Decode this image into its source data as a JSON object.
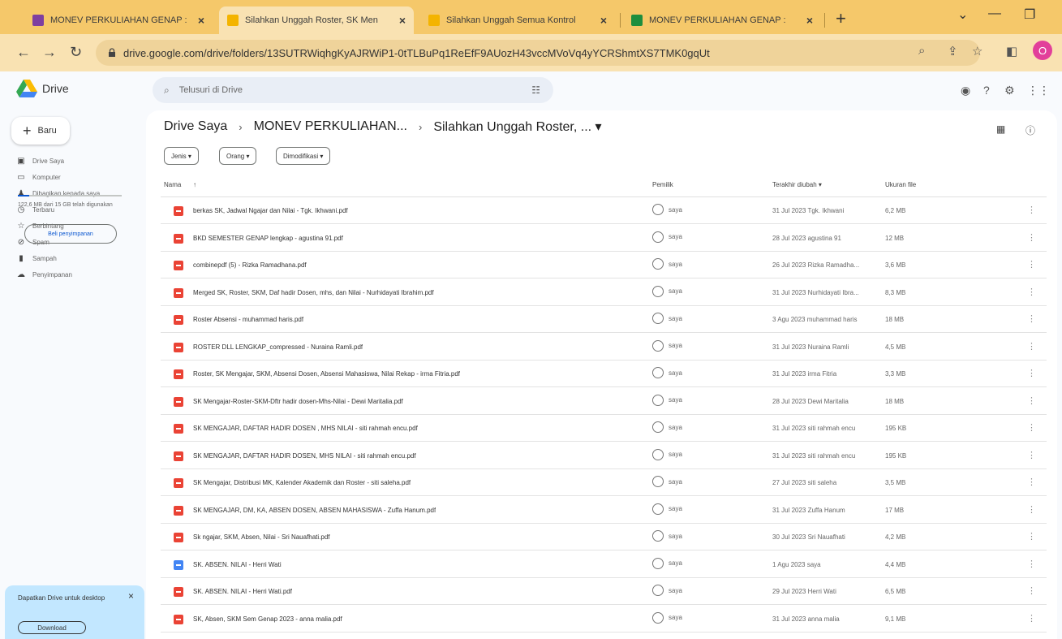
{
  "browser": {
    "tabs": [
      {
        "title": "MONEV PERKULIAHAN GENAP :",
        "color": "#7e3fa0"
      },
      {
        "title": "Silahkan Unggah Roster, SK Men",
        "color": "#f4b400"
      },
      {
        "title": "Silahkan Unggah Semua Kontrol",
        "color": "#f4b400"
      },
      {
        "title": "MONEV PERKULIAHAN GENAP :",
        "color": "#1e8e3e"
      }
    ],
    "url": "drive.google.com/drive/folders/13SUTRWiqhgKyAJRWiP1-0tTLBuPq1ReEfF9AUozH43vccMVoVq4yYCRShmtXS7TMK0gqUt",
    "profile_initial": "O"
  },
  "drive": {
    "logo_text": "Drive",
    "search_placeholder": "Telusuri di Drive",
    "new_label": "Baru",
    "nav": [
      {
        "label": "Drive Saya",
        "icon": "▣"
      },
      {
        "label": "Komputer",
        "icon": "▭"
      },
      {
        "label": "Dibagikan kepada saya",
        "icon": "♟"
      },
      {
        "label": "Terbaru",
        "icon": "◷"
      },
      {
        "label": "Berbintang",
        "icon": "☆"
      },
      {
        "label": "Spam",
        "icon": "⊘"
      },
      {
        "label": "Sampah",
        "icon": "▮"
      },
      {
        "label": "Penyimpanan",
        "icon": "☁"
      }
    ],
    "storage_text": "122,6 MB dari 15 GB telah digunakan",
    "buy_storage": "Beli penyimpanan",
    "promo_text": "Dapatkan Drive untuk desktop",
    "promo_button": "Download",
    "breadcrumb": [
      "Drive Saya",
      "MONEV PERKULIAHAN...",
      "Silahkan Unggah Roster, ... ▾"
    ],
    "filters": [
      "Jenis ▾",
      "Orang ▾",
      "Dimodifikasi ▾"
    ],
    "columns": {
      "name": "Nama",
      "owner": "Pemilik",
      "modified": "Terakhir diubah ▾",
      "size": "Ukuran file"
    },
    "files": [
      {
        "name": "berkas SK, Jadwal Ngajar dan Nilai - Tgk. Ikhwani.pdf",
        "type": "pdf",
        "owner": "saya",
        "modified": "31 Jul 2023 Tgk. Ikhwani",
        "size": "6,2 MB"
      },
      {
        "name": "BKD SEMESTER GENAP lengkap - agustina 91.pdf",
        "type": "pdf",
        "owner": "saya",
        "modified": "28 Jul 2023 agustina 91",
        "size": "12 MB"
      },
      {
        "name": "combinepdf (5) - Rizka Ramadhana.pdf",
        "type": "pdf",
        "owner": "saya",
        "modified": "26 Jul 2023 Rizka Ramadha...",
        "size": "3,6 MB"
      },
      {
        "name": "Merged SK, Roster, SKM, Daf hadir Dosen, mhs, dan Nilai - Nurhidayati Ibrahim.pdf",
        "type": "pdf",
        "owner": "saya",
        "modified": "31 Jul 2023 Nurhidayati Ibra...",
        "size": "8,3 MB"
      },
      {
        "name": "Roster Absensi - muhammad haris.pdf",
        "type": "pdf",
        "owner": "saya",
        "modified": "3 Agu 2023 muhammad haris",
        "size": "18 MB"
      },
      {
        "name": "ROSTER DLL LENGKAP_compressed - Nuraina Ramli.pdf",
        "type": "pdf",
        "owner": "saya",
        "modified": "31 Jul 2023 Nuraina Ramli",
        "size": "4,5 MB"
      },
      {
        "name": "Roster, SK Mengajar, SKM, Absensi Dosen, Absensi Mahasiswa, Nilai Rekap - irma Fitria.pdf",
        "type": "pdf",
        "owner": "saya",
        "modified": "31 Jul 2023 irma Fitria",
        "size": "3,3 MB"
      },
      {
        "name": "SK Mengajar-Roster-SKM-Dftr hadir dosen-Mhs-Nilai - Dewi Maritalia.pdf",
        "type": "pdf",
        "owner": "saya",
        "modified": "28 Jul 2023 Dewi Maritalia",
        "size": "18 MB"
      },
      {
        "name": "SK MENGAJAR, DAFTAR HADIR DOSEN , MHS NILAI - siti rahmah encu.pdf",
        "type": "pdf",
        "owner": "saya",
        "modified": "31 Jul 2023 siti rahmah encu",
        "size": "195 KB"
      },
      {
        "name": "SK MENGAJAR, DAFTAR HADIR DOSEN, MHS NILAI - siti rahmah encu.pdf",
        "type": "pdf",
        "owner": "saya",
        "modified": "31 Jul 2023 siti rahmah encu",
        "size": "195 KB"
      },
      {
        "name": "SK Mengajar, Distribusi MK, Kalender Akademik dan Roster - siti saleha.pdf",
        "type": "pdf",
        "owner": "saya",
        "modified": "27 Jul 2023 siti saleha",
        "size": "3,5 MB"
      },
      {
        "name": "SK MENGAJAR, DM, KA, ABSEN DOSEN, ABSEN MAHASISWA - Zuffa Hanum.pdf",
        "type": "pdf",
        "owner": "saya",
        "modified": "31 Jul 2023 Zuffa Hanum",
        "size": "17 MB"
      },
      {
        "name": "Sk ngajar, SKM, Absen, Nilai - Sri Nauafhati.pdf",
        "type": "pdf",
        "owner": "saya",
        "modified": "30 Jul 2023 Sri Nauafhati",
        "size": "4,2 MB"
      },
      {
        "name": "SK. ABSEN. NILAI - Herri Wati",
        "type": "doc",
        "owner": "saya",
        "modified": "1 Agu 2023 saya",
        "size": "4,4 MB"
      },
      {
        "name": "SK. ABSEN. NILAI - Herri Wati.pdf",
        "type": "pdf",
        "owner": "saya",
        "modified": "29 Jul 2023 Herri Wati",
        "size": "6,5 MB"
      },
      {
        "name": "SK, Absen, SKM Sem Genap 2023 - anna malia.pdf",
        "type": "pdf",
        "owner": "saya",
        "modified": "31 Jul 2023 anna malia",
        "size": "9,1 MB"
      }
    ]
  }
}
